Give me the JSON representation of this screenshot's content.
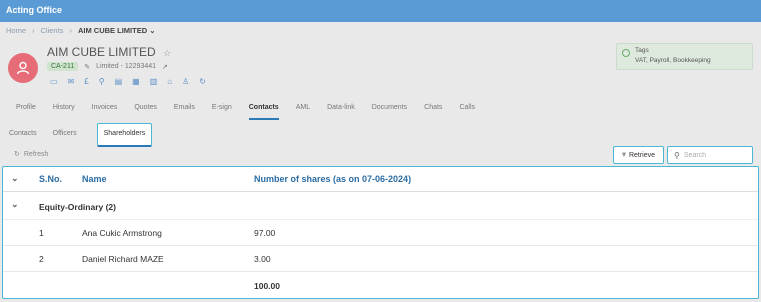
{
  "app": {
    "title": "Acting Office"
  },
  "breadcrumb": {
    "items": [
      "Home",
      "Clients"
    ],
    "current": "AIM CUBE LIMITED"
  },
  "client": {
    "name": "AIM CUBE LIMITED",
    "code": "CA-211",
    "type_number": "Limited - 12293441",
    "avatar_color": "#e66d78"
  },
  "quick_icons": [
    "chat-icon",
    "mail-icon",
    "pound-icon",
    "search-money-icon",
    "document-icon",
    "grid-icon",
    "building-icon",
    "lock-icon",
    "person-icon",
    "refresh-arrow-icon"
  ],
  "tags": {
    "label": "Tags",
    "values": "VAT, Payroll, Bookkeeping"
  },
  "main_tabs": [
    "Profile",
    "History",
    "Invoices",
    "Quotes",
    "Emails",
    "E-sign",
    "Contacts",
    "AML",
    "Data-link",
    "Documents",
    "Chats",
    "Calls"
  ],
  "main_tab_active": "Contacts",
  "sub_tabs": [
    "Contacts",
    "Officers",
    "Shareholders"
  ],
  "sub_tab_active": "Shareholders",
  "toolbar": {
    "refresh_label": "Refresh",
    "retrieve_label": "Retrieve",
    "search_placeholder": "Search"
  },
  "grid": {
    "columns": [
      "S.No.",
      "Name",
      "Number of shares (as on 07-06-2024)"
    ],
    "group_label": "Equity-Ordinary (2)",
    "rows": [
      {
        "sno": "1",
        "name": "Ana Cukic Armstrong",
        "shares": "97.00"
      },
      {
        "sno": "2",
        "name": "Daniel Richard MAZE",
        "shares": "3.00"
      }
    ],
    "total": "100.00"
  },
  "colors": {
    "accent": "#5b9bd5",
    "focus_border": "#4cb6d6",
    "header_text": "#2b6ca3"
  }
}
